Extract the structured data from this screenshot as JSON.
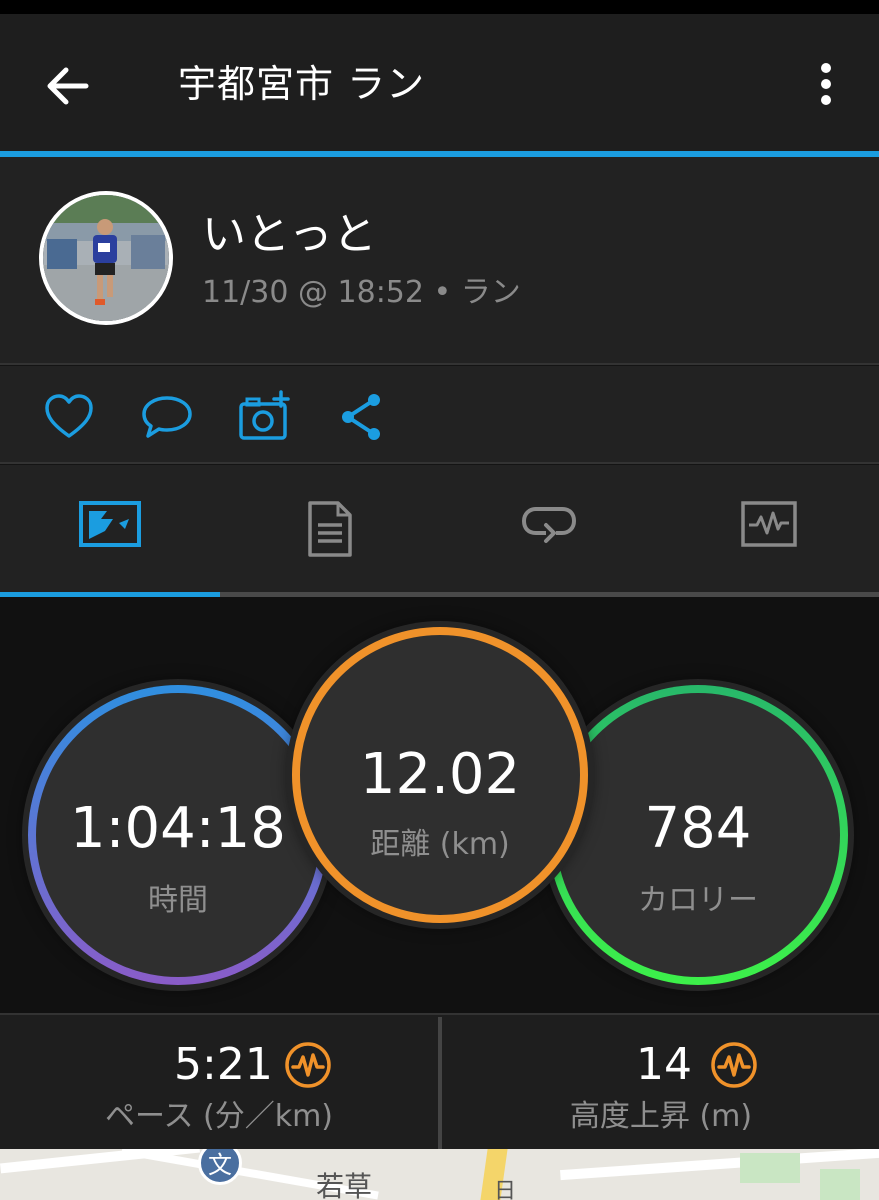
{
  "appbar": {
    "title": "宇都宮市 ラン"
  },
  "profile": {
    "username": "いとっと",
    "meta": "11/30 @ 18:52 • ラン"
  },
  "actions": [
    "heart-icon",
    "comment-icon",
    "add-photo-icon",
    "share-icon"
  ],
  "tabs": [
    {
      "name": "overview",
      "icon": "map-overview-icon",
      "active": true
    },
    {
      "name": "details",
      "icon": "document-list-icon",
      "active": false
    },
    {
      "name": "laps",
      "icon": "loop-icon",
      "active": false
    },
    {
      "name": "charts",
      "icon": "chart-pulse-icon",
      "active": false
    }
  ],
  "stats": {
    "time": {
      "value": "1:04:18",
      "label": "時間"
    },
    "distance": {
      "value": "12.02",
      "label": "距離 (km)"
    },
    "calories": {
      "value": "784",
      "label": "カロリー"
    }
  },
  "bottom_stats": {
    "pace": {
      "value": "5:21",
      "label": "ペース (分／km)"
    },
    "elevation": {
      "value": "14",
      "label": "高度上昇 (m)"
    }
  },
  "map": {
    "school_symbol": "文",
    "place_label": "若草",
    "road_label": "日"
  },
  "colors": {
    "accent": "#1b9de0",
    "distance_ring": "#f0922a",
    "time_ring_top": "#2f8fe0",
    "time_ring_bottom": "#8a5cc8",
    "calories_ring": "#3df04a",
    "stat_icon": "#f0922a"
  }
}
